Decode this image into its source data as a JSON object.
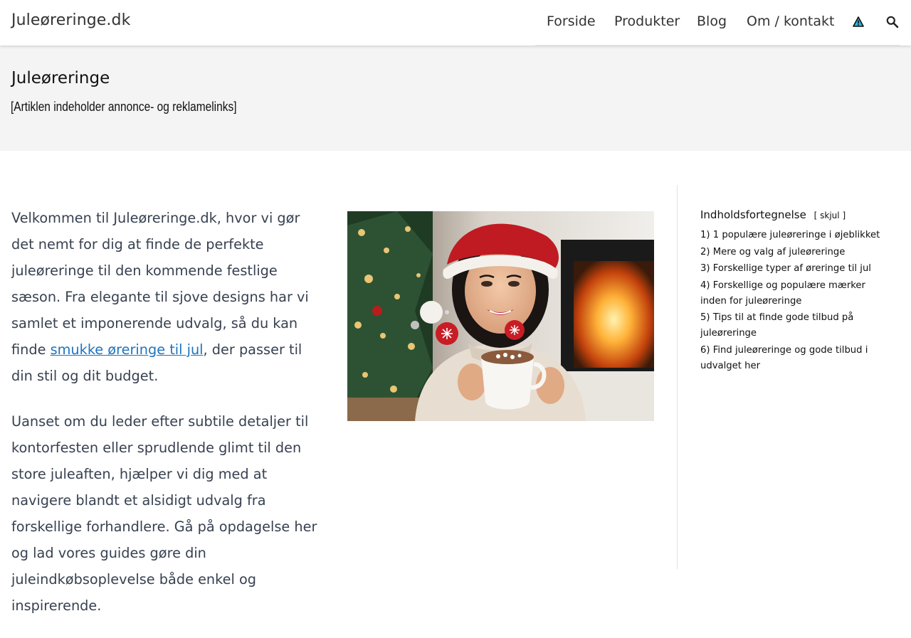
{
  "header": {
    "brand": "Juleøreringe.dk",
    "nav": [
      {
        "label": "Forside"
      },
      {
        "label": "Produkter"
      },
      {
        "label": "Blog"
      },
      {
        "label": "Om / kontakt"
      }
    ],
    "icons": [
      "warning-triangle-icon",
      "search-icon"
    ]
  },
  "hero": {
    "title": "Juleøreringe",
    "note": "[Artiklen indeholder annonce- og reklamelinks]"
  },
  "article": {
    "p1_before": "Velkommen til Juleøreringe.dk, hvor vi gør det nemt for dig at finde de perfekte juleøreringe til den kommende festlige sæson. Fra elegante til sjove designs har vi samlet et imponerende udvalg, så du kan finde ",
    "p1_link": "smukke øreringe til jul",
    "p1_after": ", der passer til din stil og dit budget.",
    "p2": "Uanset om du leder efter subtile detaljer til kontorfesten eller sprudlende glimt til den store juleaften, hjælper vi dig med at navigere blandt et alsidigt udvalg fra forskellige forhandlere. Gå på opdagelse her og lad vores guides gøre din juleindkøbsoplevelse både enkel og inspirerende."
  },
  "toc": {
    "title": "Indholdsfortegnelse",
    "toggle_open": "[",
    "toggle_label": "skjul",
    "toggle_close": "]",
    "items": [
      {
        "num": "1)",
        "label": "1 populære juleøreringe i øjeblikket"
      },
      {
        "num": "2)",
        "label": "Mere og valg af juleøreringe"
      },
      {
        "num": "3)",
        "label": "Forskellige typer af øreringe til jul"
      },
      {
        "num": "4)",
        "label": "Forskellige og populære mærker inden for juleøreringe"
      },
      {
        "num": "5)",
        "label": "Tips til at finde gode tilbud på juleøreringe"
      },
      {
        "num": "6)",
        "label": "Find juleøreringe og gode tilbud i udvalget her"
      }
    ]
  },
  "colors": {
    "link": "#1e73be",
    "body_text": "#374151",
    "hero_bg": "#f4f4f4"
  }
}
